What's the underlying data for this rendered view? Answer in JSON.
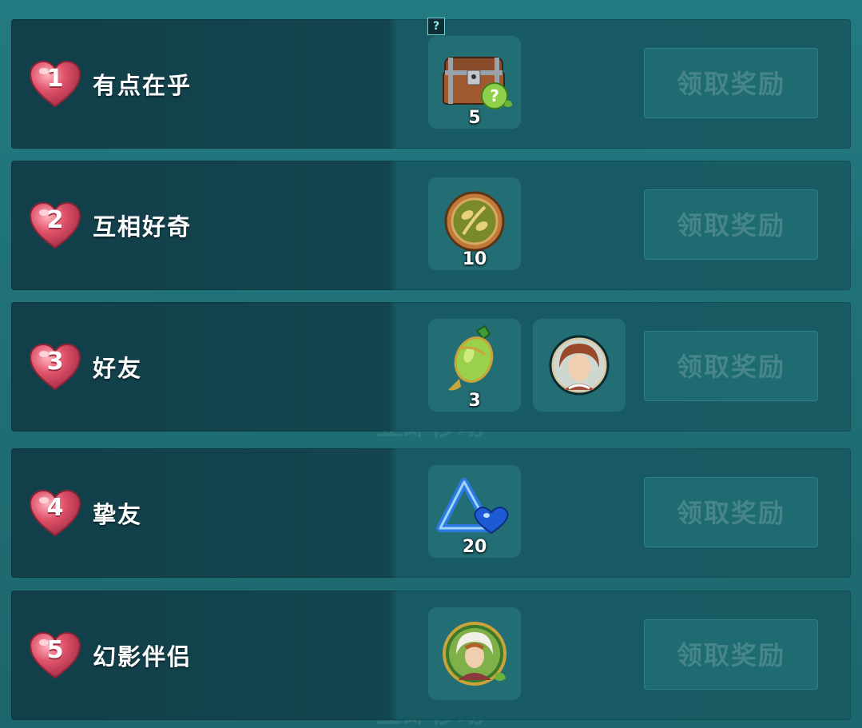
{
  "tiers": [
    {
      "level": "1",
      "name": "有点在乎",
      "button": "领取奖励",
      "rewards": [
        {
          "icon": "treasure-chest-icon",
          "qty": "5",
          "hint": "?"
        }
      ]
    },
    {
      "level": "2",
      "name": "互相好奇",
      "button": "领取奖励",
      "rewards": [
        {
          "icon": "bronze-token-icon",
          "qty": "10"
        }
      ]
    },
    {
      "level": "3",
      "name": "好友",
      "button": "领取奖励",
      "rewards": [
        {
          "icon": "green-potion-vase-icon",
          "qty": "3"
        },
        {
          "icon": "character-portrait-icon",
          "qty": ""
        }
      ]
    },
    {
      "level": "4",
      "name": "挚友",
      "button": "领取奖励",
      "rewards": [
        {
          "icon": "blue-crystal-triangle-icon",
          "qty": "20"
        }
      ]
    },
    {
      "level": "5",
      "name": "幻影伴侣",
      "button": "领取奖励",
      "rewards": [
        {
          "icon": "character-frame-icon",
          "qty": ""
        }
      ]
    }
  ],
  "colors": {
    "heart": "#e0546b",
    "row_bg": "#134550",
    "button_bg": "#1f6b72",
    "button_text": "#46858a"
  }
}
